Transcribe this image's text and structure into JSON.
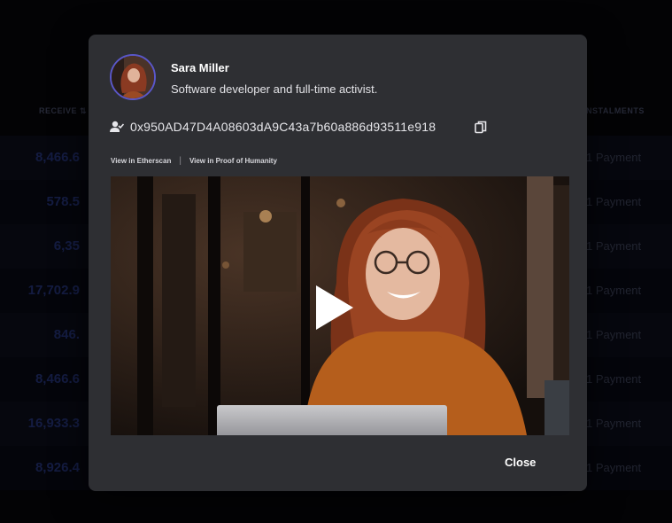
{
  "background_table": {
    "col_header_left": "RECEIVE ⇅",
    "col_header_right": "NSTALMENTS",
    "rows": [
      {
        "amount": "8,466.6",
        "payment": "1 Payment"
      },
      {
        "amount": "578.5",
        "payment": "1 Payment"
      },
      {
        "amount": "6,35",
        "payment": "1 Payment"
      },
      {
        "amount": "17,702.9",
        "payment": "1 Payment"
      },
      {
        "amount": "846.",
        "payment": "1 Payment"
      },
      {
        "amount": "8,466.6",
        "payment": "1 Payment"
      },
      {
        "amount": "16,933.3",
        "payment": "1 Payment"
      },
      {
        "amount": "8,926.4",
        "payment": "1 Payment"
      }
    ]
  },
  "modal": {
    "name": "Sara Miller",
    "bio": "Software developer and full-time activist.",
    "address": "0x950AD47D4A08603dA9C43a7b60a886d93511e918",
    "link_etherscan": "View in Etherscan",
    "link_separator": "|",
    "link_poh": "View in Proof of Humanity",
    "close_label": "Close"
  },
  "icons": {
    "address": "user-check-icon",
    "copy": "copy-icon",
    "play": "play-icon"
  },
  "colors": {
    "modal_bg": "#2e2f33",
    "avatar_border": "#5a57c9",
    "background_amount": "#1f2c66"
  }
}
